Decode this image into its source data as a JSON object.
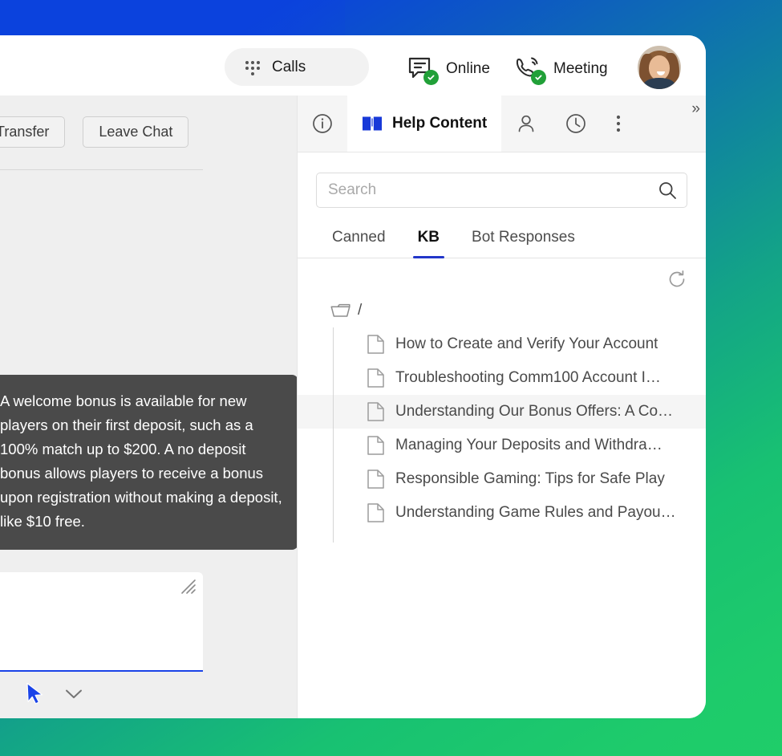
{
  "topbar": {
    "calls_label": "Calls",
    "calls_icon": "grid-dots-icon",
    "online_label": "Online",
    "online_icon": "chat-bubble-check-icon",
    "meeting_label": "Meeting",
    "meeting_icon": "phone-ring-check-icon",
    "avatar_icon": "user-avatar"
  },
  "chat": {
    "transfer_label": "Transfer",
    "leave_chat_label": "Leave Chat",
    "tooltip_text": "A welcome bonus is available for new players on their first deposit, such as a 100% match up to $200. A no deposit bonus allows players to receive a bonus upon registration without making a deposit, like $10 free.",
    "composer": {
      "resize_icon": "resize-handle-icon",
      "send_cursor_icon": "cursor-pointer-icon",
      "chevron_icon": "chevron-down-icon"
    }
  },
  "panel": {
    "tabs": [
      {
        "label": "",
        "icon": "info-circle-icon",
        "active": false
      },
      {
        "label": "Help Content",
        "icon": "book-icon",
        "active": true
      },
      {
        "label": "",
        "icon": "person-icon",
        "active": false
      },
      {
        "label": "",
        "icon": "clock-icon",
        "active": false
      },
      {
        "label": "",
        "icon": "more-vertical-icon",
        "active": false
      }
    ],
    "expand_label": "»",
    "search": {
      "placeholder": "Search",
      "value": "",
      "icon": "search-icon"
    },
    "kb_tabs": [
      {
        "label": "Canned",
        "active": false
      },
      {
        "label": "KB",
        "active": true
      },
      {
        "label": "Bot Responses",
        "active": false
      }
    ],
    "refresh_icon": "refresh-icon",
    "tree": {
      "root_label": "/",
      "root_icon": "folder-icon",
      "items": [
        {
          "label": "How to Create and Verify Your Account",
          "selected": false
        },
        {
          "label": "Troubleshooting Comm100 Account I…",
          "selected": false
        },
        {
          "label": "Understanding Our Bonus Offers: A Co…",
          "selected": true
        },
        {
          "label": "Managing Your Deposits and Withdra…",
          "selected": false
        },
        {
          "label": "Responsible Gaming: Tips for Safe Play",
          "selected": false
        },
        {
          "label": "Understanding Game Rules and Payou…",
          "selected": false
        }
      ]
    }
  },
  "colors": {
    "accent_blue": "#2236c9",
    "status_green": "#21a038",
    "tooltip_bg": "#4a4a4a",
    "desktop_blue": "#0b42dd",
    "desktop_green": "#1ecb6b",
    "composer_focus": "#1a43e8"
  }
}
